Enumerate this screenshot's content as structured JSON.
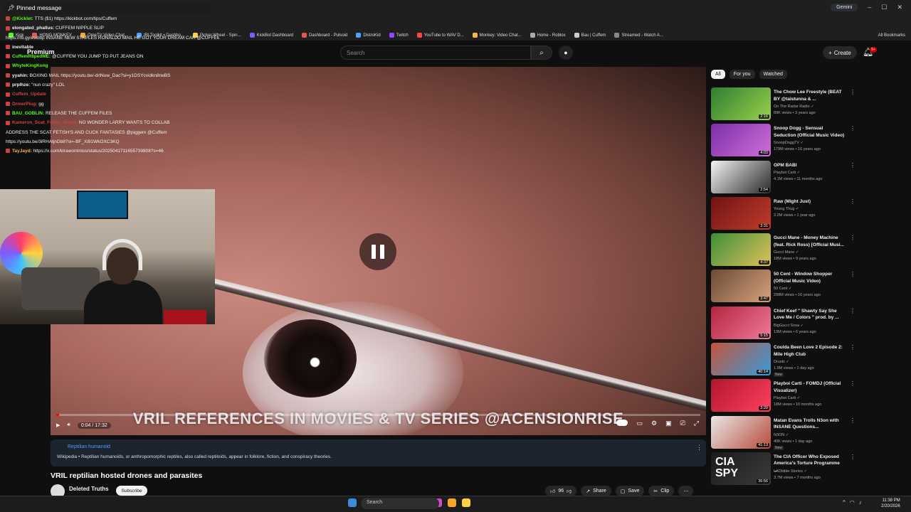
{
  "pinned": {
    "label": "Pinned message"
  },
  "chat": [
    {
      "user": "@Kicklet",
      "text": "TTS ($1) https://kickbot.com/tips/Cuffem",
      "color": "#53fc18"
    },
    {
      "user": "elongated_phallus",
      "text": "CUFFEM NIPPLE SLIP",
      "color": "#f1f1f1"
    },
    {
      "user": "",
      "text": "https://rb.gy/ewbtlp INSANE NEW STAPLES RONALDO MAIL HE GOT YOUR DREAM CAR @CUFFEM",
      "color": "#f1f1f1"
    },
    {
      "user": "inevitable",
      "text": "",
      "color": "#f1f1f1"
    },
    {
      "user": "CuffemR8pedME",
      "text": "@CUFFEM YOU JUMP TO PUT JEANS ON",
      "color": "#53fc18"
    },
    {
      "user": "WhyteKingKong",
      "text": "",
      "color": "#53fc18"
    },
    {
      "user": "yyahin",
      "text": "BOXING MAIL https://youtu.be/-drlNuw_Dac?si=y1DSYcvidkn8neBS",
      "color": "#f1f1f1"
    },
    {
      "user": "prplhze",
      "text": "\"nun crazy\" LOL",
      "color": "#f1f1f1"
    },
    {
      "user": "Cuffem_Update",
      "text": "",
      "color": "#d1413f"
    },
    {
      "user": "DrmerPlug",
      "text": "gg",
      "color": "#d1413f"
    },
    {
      "user": "BAU_GOBLIN",
      "text": "RELEASE THE CUFFEM FILES",
      "color": "#53fc18"
    },
    {
      "user": "Kameron_Scat_Fetish_Amos",
      "text": "NO WONDER LARRY WANTS TO COLLAB",
      "color": "#d1413f"
    },
    {
      "user": "",
      "text": "ADDRESS THE SCAT FETISH'S AND CUCK FANTASIES @piggem @Cuffem",
      "color": "#f1f1f1"
    },
    {
      "user": "",
      "text": "https://youtu.be/3iRHAtjnDb8?si=-BF_Xi91WkOXC3KQ",
      "color": "#f1f1f1"
    },
    {
      "user": "TayJayd",
      "text": "https://x.com/kirawontmiss/status/2025041711655739808?s=46",
      "color": "#ffb347"
    }
  ],
  "browser": {
    "gemini": "Gemini",
    "bookmarks": [
      "Kick",
      "HONG MONKEY",
      "OmeTV Video Chat...",
      "IRLToolkit • Dashbo...",
      "Picker Wheel - Spin...",
      "KickBot Dashboard",
      "Dashboard - Pulsoid",
      "DistroKid",
      "Twitch",
      "YouTube to WAV D...",
      "Monkey: Video Chat...",
      "Home - Roblox",
      "Bau | Cuffem",
      "Streamed - Watch A..."
    ],
    "all_bookmarks": "All Bookmarks"
  },
  "youtube": {
    "logo": "Premium",
    "search_placeholder": "Search",
    "create_label": "Create",
    "notif_count": "9+"
  },
  "video": {
    "caption": "VRIL REFERENCES IN MOVIES & TV SERIES @ACENSIONRISE",
    "time": "0:04 / 17:32",
    "progress": 0.004,
    "title": "VRIL reptilian hosted drones and parasites",
    "channel": "Deleted Truths",
    "subscribe": "Subscribe",
    "likes": "96",
    "share": "Share",
    "save": "Save",
    "clip": "Clip"
  },
  "info": {
    "link": "Reptilian humanoid",
    "text": "Wikipedia • Reptilian humanoids, or anthropomorphic reptiles, also called reptiloids, appear in folklore, fiction, and conspiracy theories."
  },
  "chips": [
    "All",
    "For you",
    "Watched"
  ],
  "recs": [
    {
      "title": "The Chow Lee Freestyle (BEAT BY @taistunna & ...",
      "channel": "On The Radar Radio",
      "meta": "89K views • 3 years ago",
      "dur": "2:16",
      "colors": [
        "#2f7d32",
        "#9ad14b"
      ]
    },
    {
      "title": "Snoop Dogg - Sensual Seduction (Official Music Video)",
      "channel": "SnoopDoggTV",
      "meta": "179M views • 16 years ago",
      "dur": "4:03",
      "colors": [
        "#7b2fa8",
        "#d06fd8"
      ]
    },
    {
      "title": "OPM BABI",
      "channel": "Playboi Carti",
      "meta": "4.1M views • 11 months ago",
      "dur": "2:54",
      "colors": [
        "#f5f5f5",
        "#2a2a2a"
      ]
    },
    {
      "title": "Raw (Might Just)",
      "channel": "Young Thug",
      "meta": "2.2M views • 1 year ago",
      "dur": "3:31",
      "colors": [
        "#6e1414",
        "#c23b2a"
      ]
    },
    {
      "title": "Gucci Mane - Money Machine (feat. Rick Ross) [Official Musi...",
      "channel": "Gucci Mane",
      "meta": "18M views • 9 years ago",
      "dur": "4:37",
      "colors": [
        "#3d8f3a",
        "#e0c15a"
      ]
    },
    {
      "title": "50 Cent - Window Shopper (Official Music Video)",
      "channel": "50 Cent",
      "meta": "298M views • 16 years ago",
      "dur": "3:47",
      "colors": [
        "#6b4a36",
        "#d7a27b"
      ]
    },
    {
      "title": "Chief Keef \" Shawty Say She Love Me / Colors \" prod. by ...",
      "channel": "BigGucci Sosa",
      "meta": "13M views • 6 years ago",
      "dur": "5:15",
      "colors": [
        "#b3253f",
        "#f07a9a"
      ]
    },
    {
      "title": "Coulda Been Love 2 Episode 2: Mile High Club",
      "channel": "Druski",
      "meta": "1.9M views • 1 day ago",
      "dur": "40:14",
      "colors": [
        "#c2553b",
        "#3a9ad9"
      ]
    },
    {
      "title": "Playboi Carti - FOMDJ (Official Visualizer)",
      "channel": "Playboi Carti",
      "meta": "18M views • 10 months ago",
      "dur": "3:20",
      "colors": [
        "#b0172d",
        "#ff4060"
      ]
    },
    {
      "title": "Matan Evans Trolls N3on with INSANE Questions...",
      "channel": "N3ON",
      "meta": "40K views • 1 day ago",
      "dur": "41:13",
      "colors": [
        "#e8e8e8",
        "#b94a3a"
      ]
    },
    {
      "title": "The CIA Officer Who Exposed America's Torture Programme ...",
      "channel": "LADbible Stories",
      "meta": "3.7M views • 7 months ago",
      "dur": "36:56",
      "colors": [
        "#1b1b1b",
        "#3a3a3a"
      ]
    }
  ],
  "new_label": "New",
  "webcam_caption": "CIA SPY",
  "taskbar": {
    "search": "Search",
    "time": "11:38 PM",
    "date": "2/20/2026"
  }
}
